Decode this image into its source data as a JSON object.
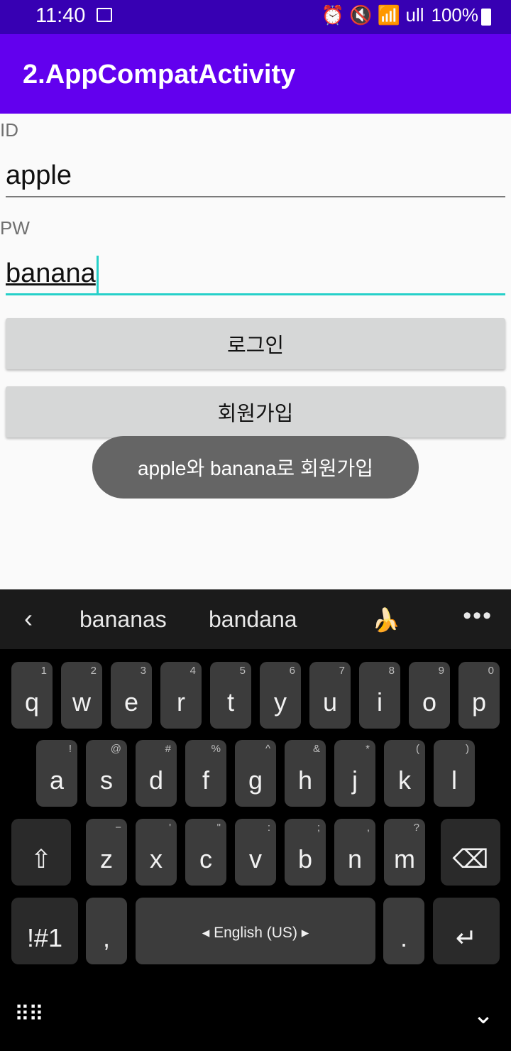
{
  "status": {
    "time": "11:40",
    "icons": "⏰ 🔇 📶 ull",
    "battery": "100%"
  },
  "appbar": {
    "title": "2.AppCompatActivity"
  },
  "form": {
    "id_label": "ID",
    "id_value": "apple",
    "pw_label": "PW",
    "pw_value": "banana",
    "login_label": "로그인",
    "signup_label": "회원가입"
  },
  "toast": "apple와 banana로 회원가입",
  "keyboard": {
    "suggestions": [
      "bananas",
      "bandana",
      "🍌"
    ],
    "row1": [
      [
        "q",
        "1"
      ],
      [
        "w",
        "2"
      ],
      [
        "e",
        "3"
      ],
      [
        "r",
        "4"
      ],
      [
        "t",
        "5"
      ],
      [
        "y",
        "6"
      ],
      [
        "u",
        "7"
      ],
      [
        "i",
        "8"
      ],
      [
        "o",
        "9"
      ],
      [
        "p",
        "0"
      ]
    ],
    "row2": [
      [
        "a",
        "!"
      ],
      [
        "s",
        "@"
      ],
      [
        "d",
        "#"
      ],
      [
        "f",
        "%"
      ],
      [
        "g",
        "^"
      ],
      [
        "h",
        "&"
      ],
      [
        "j",
        "*"
      ],
      [
        "k",
        "("
      ],
      [
        "l",
        ")"
      ]
    ],
    "row3": [
      [
        "z",
        "−"
      ],
      [
        "x",
        "'"
      ],
      [
        "c",
        "\""
      ],
      [
        "v",
        ":"
      ],
      [
        "b",
        ";"
      ],
      [
        "n",
        ","
      ],
      [
        "m",
        "?"
      ]
    ],
    "symbols": "!#1",
    "comma": ",",
    "space": "English (US)",
    "period": "."
  }
}
